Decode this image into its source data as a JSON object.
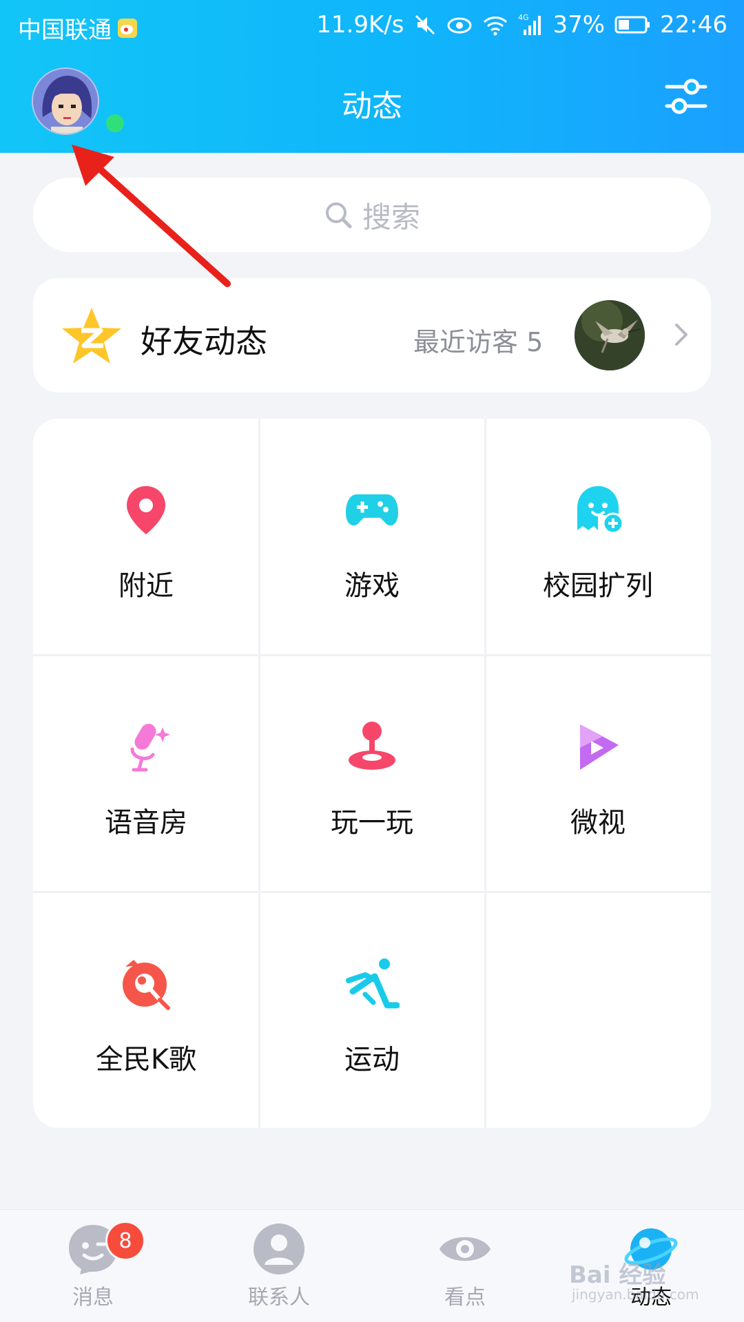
{
  "status_bar": {
    "carrier": "中国联通",
    "speed": "11.9K/s",
    "network": "4G",
    "battery": "37%",
    "time": "22:46"
  },
  "header": {
    "title": "动态"
  },
  "search": {
    "placeholder": "搜索"
  },
  "friend_feed": {
    "title": "好友动态",
    "visitors_label": "最近访客 5"
  },
  "grid": {
    "items": [
      {
        "label": "附近",
        "icon": "location-pin-icon",
        "color": "#f6466a"
      },
      {
        "label": "游戏",
        "icon": "gamepad-icon",
        "color": "#1fd0e6"
      },
      {
        "label": "校园扩列",
        "icon": "ghost-plus-icon",
        "color": "#1ed3ef"
      },
      {
        "label": "语音房",
        "icon": "microphone-icon",
        "color": "#f57ad8"
      },
      {
        "label": "玩一玩",
        "icon": "joystick-icon",
        "color": "#f6466a"
      },
      {
        "label": "微视",
        "icon": "play-icon",
        "color": "#c46af0"
      },
      {
        "label": "全民K歌",
        "icon": "karaoke-icon",
        "color": "#f6564a"
      },
      {
        "label": "运动",
        "icon": "running-icon",
        "color": "#19cbe9"
      }
    ]
  },
  "bottom_nav": {
    "tabs": [
      {
        "label": "消息",
        "badge": "8"
      },
      {
        "label": "联系人"
      },
      {
        "label": "看点"
      },
      {
        "label": "动态"
      }
    ]
  },
  "watermark": {
    "text": "Bai 经验",
    "sub": "jingyan.baidu.com"
  },
  "colors": {
    "header_start": "#12c5f7",
    "header_end": "#1aa0ff",
    "background": "#f3f4f8",
    "badge": "#f74c3c",
    "online": "#2fe07a",
    "arrow": "#e8221b"
  }
}
